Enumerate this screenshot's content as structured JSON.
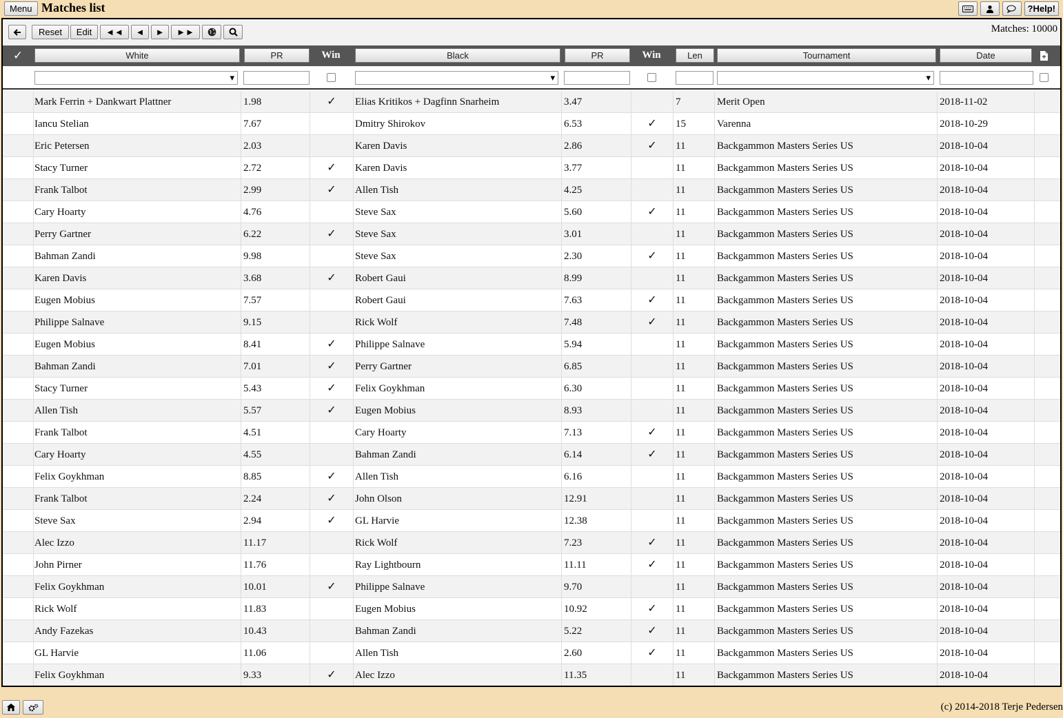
{
  "topbar": {
    "menu_label": "Menu",
    "title": "Matches list",
    "help_label": "?Help!"
  },
  "toolbar": {
    "back_icon": "arrow-left-icon",
    "reset_label": "Reset",
    "edit_label": "Edit",
    "first_label": "◄◄",
    "prev_label": "◄",
    "next_label": "►",
    "last_label": "►►",
    "matches_count": "Matches: 10000"
  },
  "columns": {
    "select": "✓",
    "white": "White",
    "white_pr": "PR",
    "white_win": "Win",
    "black": "Black",
    "black_pr": "PR",
    "black_win": "Win",
    "len": "Len",
    "tournament": "Tournament",
    "date": "Date"
  },
  "filters": {
    "white_select": "",
    "white_pr": "",
    "black_select": "",
    "black_pr": "",
    "len": "",
    "tournament_select": "",
    "date": ""
  },
  "rows": [
    {
      "white": "Mark Ferrin + Dankwart Plattner",
      "wpr": "1.98",
      "wwin": "✓",
      "black": "Elias Kritikos + Dagfinn Snarheim",
      "bpr": "3.47",
      "bwin": "",
      "len": "7",
      "tournament": "Merit Open",
      "date": "2018-11-02"
    },
    {
      "white": "Iancu Stelian",
      "wpr": "7.67",
      "wwin": "",
      "black": "Dmitry Shirokov",
      "bpr": "6.53",
      "bwin": "✓",
      "len": "15",
      "tournament": "Varenna",
      "date": "2018-10-29"
    },
    {
      "white": "Eric Petersen",
      "wpr": "2.03",
      "wwin": "",
      "black": "Karen Davis",
      "bpr": "2.86",
      "bwin": "✓",
      "len": "11",
      "tournament": "Backgammon Masters Series US",
      "date": "2018-10-04"
    },
    {
      "white": "Stacy Turner",
      "wpr": "2.72",
      "wwin": "✓",
      "black": "Karen Davis",
      "bpr": "3.77",
      "bwin": "",
      "len": "11",
      "tournament": "Backgammon Masters Series US",
      "date": "2018-10-04"
    },
    {
      "white": "Frank Talbot",
      "wpr": "2.99",
      "wwin": "✓",
      "black": "Allen Tish",
      "bpr": "4.25",
      "bwin": "",
      "len": "11",
      "tournament": "Backgammon Masters Series US",
      "date": "2018-10-04"
    },
    {
      "white": "Cary Hoarty",
      "wpr": "4.76",
      "wwin": "",
      "black": "Steve Sax",
      "bpr": "5.60",
      "bwin": "✓",
      "len": "11",
      "tournament": "Backgammon Masters Series US",
      "date": "2018-10-04"
    },
    {
      "white": "Perry Gartner",
      "wpr": "6.22",
      "wwin": "✓",
      "black": "Steve Sax",
      "bpr": "3.01",
      "bwin": "",
      "len": "11",
      "tournament": "Backgammon Masters Series US",
      "date": "2018-10-04"
    },
    {
      "white": "Bahman Zandi",
      "wpr": "9.98",
      "wwin": "",
      "black": "Steve Sax",
      "bpr": "2.30",
      "bwin": "✓",
      "len": "11",
      "tournament": "Backgammon Masters Series US",
      "date": "2018-10-04"
    },
    {
      "white": "Karen Davis",
      "wpr": "3.68",
      "wwin": "✓",
      "black": "Robert Gaui",
      "bpr": "8.99",
      "bwin": "",
      "len": "11",
      "tournament": "Backgammon Masters Series US",
      "date": "2018-10-04"
    },
    {
      "white": "Eugen Mobius",
      "wpr": "7.57",
      "wwin": "",
      "black": "Robert Gaui",
      "bpr": "7.63",
      "bwin": "✓",
      "len": "11",
      "tournament": "Backgammon Masters Series US",
      "date": "2018-10-04"
    },
    {
      "white": "Philippe Salnave",
      "wpr": "9.15",
      "wwin": "",
      "black": "Rick Wolf",
      "bpr": "7.48",
      "bwin": "✓",
      "len": "11",
      "tournament": "Backgammon Masters Series US",
      "date": "2018-10-04"
    },
    {
      "white": "Eugen Mobius",
      "wpr": "8.41",
      "wwin": "✓",
      "black": "Philippe Salnave",
      "bpr": "5.94",
      "bwin": "",
      "len": "11",
      "tournament": "Backgammon Masters Series US",
      "date": "2018-10-04"
    },
    {
      "white": "Bahman Zandi",
      "wpr": "7.01",
      "wwin": "✓",
      "black": "Perry Gartner",
      "bpr": "6.85",
      "bwin": "",
      "len": "11",
      "tournament": "Backgammon Masters Series US",
      "date": "2018-10-04"
    },
    {
      "white": "Stacy Turner",
      "wpr": "5.43",
      "wwin": "✓",
      "black": "Felix Goykhman",
      "bpr": "6.30",
      "bwin": "",
      "len": "11",
      "tournament": "Backgammon Masters Series US",
      "date": "2018-10-04"
    },
    {
      "white": "Allen Tish",
      "wpr": "5.57",
      "wwin": "✓",
      "black": "Eugen Mobius",
      "bpr": "8.93",
      "bwin": "",
      "len": "11",
      "tournament": "Backgammon Masters Series US",
      "date": "2018-10-04"
    },
    {
      "white": "Frank Talbot",
      "wpr": "4.51",
      "wwin": "",
      "black": "Cary Hoarty",
      "bpr": "7.13",
      "bwin": "✓",
      "len": "11",
      "tournament": "Backgammon Masters Series US",
      "date": "2018-10-04"
    },
    {
      "white": "Cary Hoarty",
      "wpr": "4.55",
      "wwin": "",
      "black": "Bahman Zandi",
      "bpr": "6.14",
      "bwin": "✓",
      "len": "11",
      "tournament": "Backgammon Masters Series US",
      "date": "2018-10-04"
    },
    {
      "white": "Felix Goykhman",
      "wpr": "8.85",
      "wwin": "✓",
      "black": "Allen Tish",
      "bpr": "6.16",
      "bwin": "",
      "len": "11",
      "tournament": "Backgammon Masters Series US",
      "date": "2018-10-04"
    },
    {
      "white": "Frank Talbot",
      "wpr": "2.24",
      "wwin": "✓",
      "black": "John Olson",
      "bpr": "12.91",
      "bwin": "",
      "len": "11",
      "tournament": "Backgammon Masters Series US",
      "date": "2018-10-04"
    },
    {
      "white": "Steve Sax",
      "wpr": "2.94",
      "wwin": "✓",
      "black": "GL Harvie",
      "bpr": "12.38",
      "bwin": "",
      "len": "11",
      "tournament": "Backgammon Masters Series US",
      "date": "2018-10-04"
    },
    {
      "white": "Alec Izzo",
      "wpr": "11.17",
      "wwin": "",
      "black": "Rick Wolf",
      "bpr": "7.23",
      "bwin": "✓",
      "len": "11",
      "tournament": "Backgammon Masters Series US",
      "date": "2018-10-04"
    },
    {
      "white": "John Pirner",
      "wpr": "11.76",
      "wwin": "",
      "black": "Ray Lightbourn",
      "bpr": "11.11",
      "bwin": "✓",
      "len": "11",
      "tournament": "Backgammon Masters Series US",
      "date": "2018-10-04"
    },
    {
      "white": "Felix Goykhman",
      "wpr": "10.01",
      "wwin": "✓",
      "black": "Philippe Salnave",
      "bpr": "9.70",
      "bwin": "",
      "len": "11",
      "tournament": "Backgammon Masters Series US",
      "date": "2018-10-04"
    },
    {
      "white": "Rick Wolf",
      "wpr": "11.83",
      "wwin": "",
      "black": "Eugen Mobius",
      "bpr": "10.92",
      "bwin": "✓",
      "len": "11",
      "tournament": "Backgammon Masters Series US",
      "date": "2018-10-04"
    },
    {
      "white": "Andy Fazekas",
      "wpr": "10.43",
      "wwin": "",
      "black": "Bahman Zandi",
      "bpr": "5.22",
      "bwin": "✓",
      "len": "11",
      "tournament": "Backgammon Masters Series US",
      "date": "2018-10-04"
    },
    {
      "white": "GL Harvie",
      "wpr": "11.06",
      "wwin": "",
      "black": "Allen Tish",
      "bpr": "2.60",
      "bwin": "✓",
      "len": "11",
      "tournament": "Backgammon Masters Series US",
      "date": "2018-10-04"
    },
    {
      "white": "Felix Goykhman",
      "wpr": "9.33",
      "wwin": "✓",
      "black": "Alec Izzo",
      "bpr": "11.35",
      "bwin": "",
      "len": "11",
      "tournament": "Backgammon Masters Series US",
      "date": "2018-10-04"
    }
  ],
  "footer": {
    "copyright": "(c) 2014-2018 Terje Pedersen"
  }
}
